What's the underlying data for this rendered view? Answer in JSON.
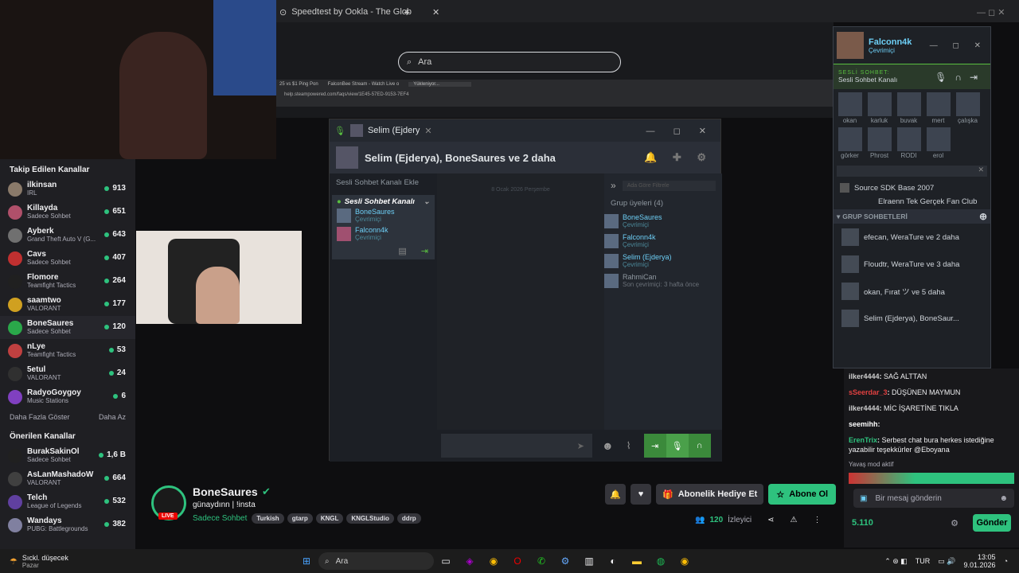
{
  "browser": {
    "tab_title": "Speedtest by Ookla - The Glob",
    "search_placeholder": "Ara",
    "inner_tabs": [
      "25 vs $1 Ping Pon",
      "FalconBee Stream - Watch Live o",
      "Yükleniyor..."
    ],
    "inner_url": "help.steampowered.com/faqs/view/1E45-57ED-9153-7EF4"
  },
  "sidebar": {
    "followed_title": "Takip Edilen Kanallar",
    "followed": [
      {
        "name": "ilkinsan",
        "game": "IRL",
        "viewers": "913",
        "color": "#8a7a6a"
      },
      {
        "name": "Killayda",
        "game": "Sadece Sohbet",
        "viewers": "651",
        "color": "#b0506a"
      },
      {
        "name": "Ayberk",
        "game": "Grand Theft Auto V (G...",
        "viewers": "643",
        "color": "#707070"
      },
      {
        "name": "Cavs",
        "game": "Sadece Sohbet",
        "viewers": "407",
        "color": "#c03030"
      },
      {
        "name": "Flomore",
        "game": "Teamfight Tactics",
        "viewers": "264",
        "color": "#202020"
      },
      {
        "name": "saamtwo",
        "game": "VALORANT",
        "viewers": "177",
        "color": "#d0a020"
      },
      {
        "name": "BoneSaures",
        "game": "Sadece Sohbet",
        "viewers": "120",
        "color": "#2aa84a"
      },
      {
        "name": "nLye",
        "game": "Teamfight Tactics",
        "viewers": "53",
        "color": "#c04040"
      },
      {
        "name": "5etul",
        "game": "VALORANT",
        "viewers": "24",
        "color": "#303030"
      },
      {
        "name": "RadyoGoygoy",
        "game": "Music Stations",
        "viewers": "6",
        "color": "#8040c0"
      }
    ],
    "show_more": "Daha Fazla Göster",
    "show_less": "Daha Az",
    "recommended_title": "Önerilen Kanallar",
    "recommended": [
      {
        "name": "BurakSakinOl",
        "game": "Sadece Sohbet",
        "viewers": "1,6 B",
        "color": "#202020"
      },
      {
        "name": "AsLanMashadoW",
        "game": "VALORANT",
        "viewers": "664",
        "color": "#404040"
      },
      {
        "name": "Telch",
        "game": "League of Legends",
        "viewers": "532",
        "color": "#6040a0"
      },
      {
        "name": "Wandays",
        "game": "PUBG: Battlegrounds",
        "viewers": "382",
        "color": "#8080a0"
      }
    ]
  },
  "steam_chat": {
    "tab_label": "Selim (Ejdery",
    "header": "Selim (Ejderya), BoneSaures ve 2 daha",
    "add_voice": "Sesli Sohbet Kanalı Ekle",
    "voice_channel": "Sesli Sohbet Kanalı",
    "voice_members": [
      {
        "name": "BoneSaures",
        "status": "Çevrimiçi"
      },
      {
        "name": "Falconn4k",
        "status": "Çevrimiçi"
      }
    ],
    "date_sep": "8 Ocak 2026 Perşembe",
    "filter_placeholder": "Ada Göre Filtrele",
    "group_members_label": "Grup üyeleri",
    "group_count": "(4)",
    "members": [
      {
        "name": "BoneSaures",
        "status": "Çevrimiçi",
        "online": true
      },
      {
        "name": "Falconn4k",
        "status": "Çevrimiçi",
        "online": true
      },
      {
        "name": "Selim (Ejderya)",
        "status": "Çevrimiçi",
        "online": true
      },
      {
        "name": "RahmiCan",
        "status": "Son çevrimiçi: 3 hafta önce",
        "online": false
      }
    ]
  },
  "friends": {
    "username": "Falconn4k",
    "status": "Çevrimiçi",
    "voice_label": "SESLİ SOHBET:",
    "voice_channel": "Sesli Sohbet Kanalı",
    "friends": [
      "okan",
      "karluk",
      "buvak",
      "mert",
      "çalışka",
      "görker",
      "Phrost",
      "RODI",
      "erol"
    ],
    "game1": "Source SDK Base 2007",
    "game2": "Elraenn Tek Gerçek Fan Club",
    "groups_title": "GRUP SOHBETLERİ",
    "groups": [
      "efecan, WeraTure ve 2 daha",
      "Floudtr, WeraTure ve 3 daha",
      "okan, Fırat ツ ve 5 daha",
      "Selim (Ejderya), BoneSaur..."
    ]
  },
  "twitch_chat": {
    "messages": [
      {
        "user": "ilker4444",
        "color": "#d0d0d0",
        "text": "SAĞ ALTTAN"
      },
      {
        "user": "sSeerdar_3",
        "color": "#e04040",
        "text": "DÜŞÜNEN MAYMUN"
      },
      {
        "user": "ilker4444",
        "color": "#d0d0d0",
        "text": "MİC İŞARETİNE TIKLA"
      },
      {
        "user": "seemihh",
        "color": "#ffffff",
        "text": ""
      },
      {
        "user": "ErenTrix",
        "color": "#2ec27e",
        "text": "Serbest chat bura herkes istediğine yazabilir teşekkürler @Eboyana"
      }
    ],
    "slow_mode": "Yavaş mod aktif",
    "input_placeholder": "Bir mesaj gönderin",
    "points": "5.110",
    "send": "Gönder"
  },
  "channel": {
    "name": "BoneSaures",
    "title": "günaydınn | !insta",
    "category": "Sadece Sohbet",
    "tags": [
      "Turkish",
      "gtarp",
      "KNGL",
      "KNGLStudio",
      "ddrp"
    ],
    "live": "LIVE",
    "gift_sub": "Abonelik Hediye Et",
    "subscribe": "Abone Ol",
    "viewers": "120",
    "viewers_label": "İzleyici"
  },
  "taskbar": {
    "weather": "Sıckl. düşecek",
    "weather_sub": "Pazar",
    "search": "Ara",
    "lang": "TUR",
    "time": "13:05",
    "date": "9.01.2026"
  }
}
